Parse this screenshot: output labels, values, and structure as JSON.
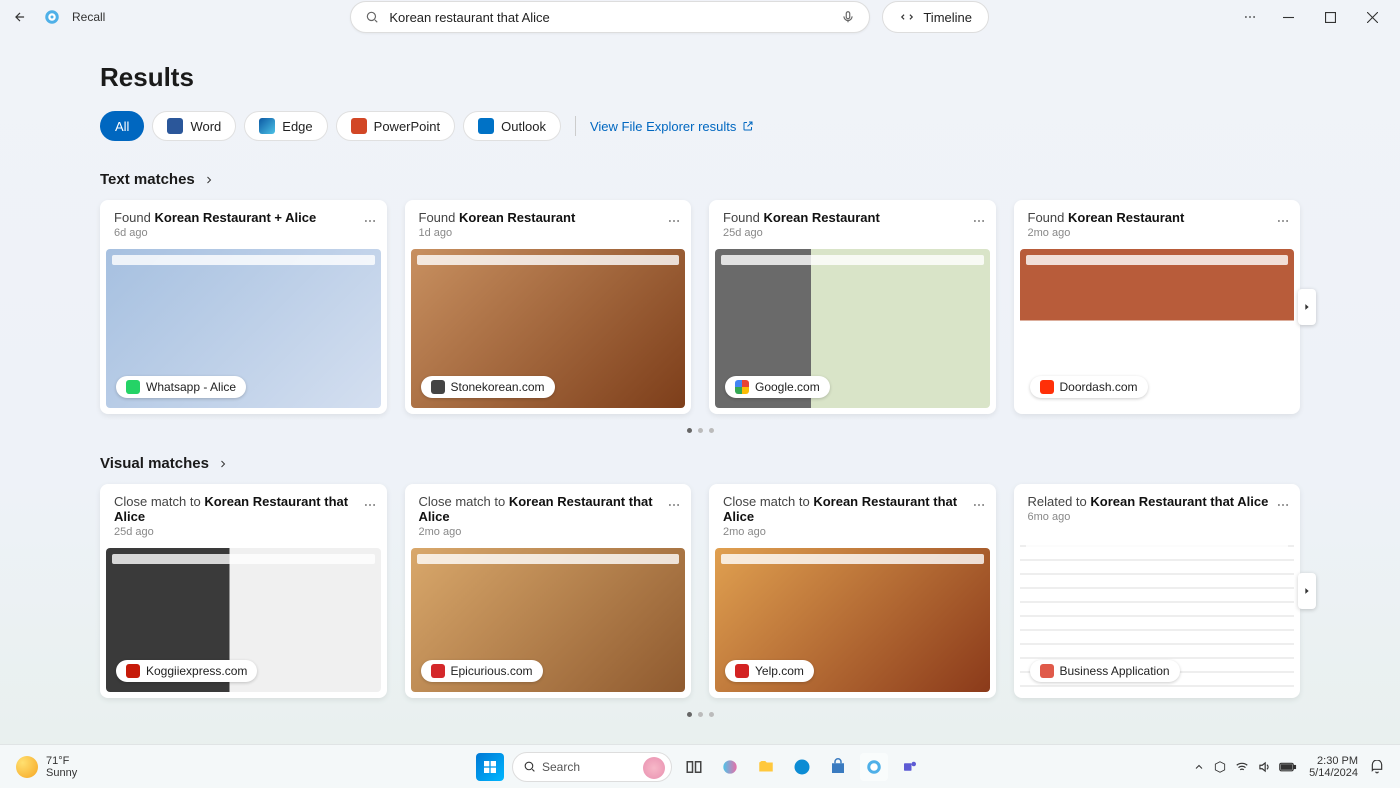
{
  "app": {
    "name": "Recall"
  },
  "search": {
    "query": "Korean restaurant that Alice"
  },
  "timeline": {
    "label": "Timeline"
  },
  "page": {
    "title": "Results"
  },
  "filters": {
    "all": "All",
    "word": "Word",
    "edge": "Edge",
    "ppt": "PowerPoint",
    "outlook": "Outlook",
    "explorer_link": "View File Explorer results"
  },
  "sections": {
    "text": "Text matches",
    "visual": "Visual matches"
  },
  "text_cards": [
    {
      "prefix": "Found ",
      "bold": "Korean Restaurant + Alice",
      "time": "6d ago",
      "src": "Whatsapp - Alice",
      "dot": "d-wa",
      "thumb": "whatsapp"
    },
    {
      "prefix": "Found ",
      "bold": "Korean Restaurant",
      "time": "1d ago",
      "src": "Stonekorean.com",
      "dot": "d-st",
      "thumb": "food"
    },
    {
      "prefix": "Found ",
      "bold": "Korean Restaurant",
      "time": "25d ago",
      "src": "Google.com",
      "dot": "d-gg",
      "thumb": "map"
    },
    {
      "prefix": "Found ",
      "bold": "Korean Restaurant",
      "time": "2mo ago",
      "src": "Doordash.com",
      "dot": "d-dd",
      "thumb": "dd"
    }
  ],
  "visual_cards": [
    {
      "prefix": "Close match to ",
      "bold": "Korean Restaurant that Alice",
      "time": "25d ago",
      "src": "Koggiiexpress.com",
      "dot": "d-kg",
      "thumb": "menu"
    },
    {
      "prefix": "Close match to ",
      "bold": "Korean Restaurant that Alice",
      "time": "2mo ago",
      "src": "Epicurious.com",
      "dot": "d-ep",
      "thumb": "rice"
    },
    {
      "prefix": "Close match to ",
      "bold": "Korean Restaurant that Alice",
      "time": "2mo ago",
      "src": "Yelp.com",
      "dot": "d-yp",
      "thumb": "bibim"
    },
    {
      "prefix": "Related to ",
      "bold": "Korean Restaurant that Alice",
      "time": "6mo ago",
      "src": "Business Application",
      "dot": "d-ba",
      "thumb": "doc"
    }
  ],
  "taskbar": {
    "weather_temp": "71°F",
    "weather_desc": "Sunny",
    "search_ph": "Search",
    "time": "2:30 PM",
    "date": "5/14/2024"
  }
}
